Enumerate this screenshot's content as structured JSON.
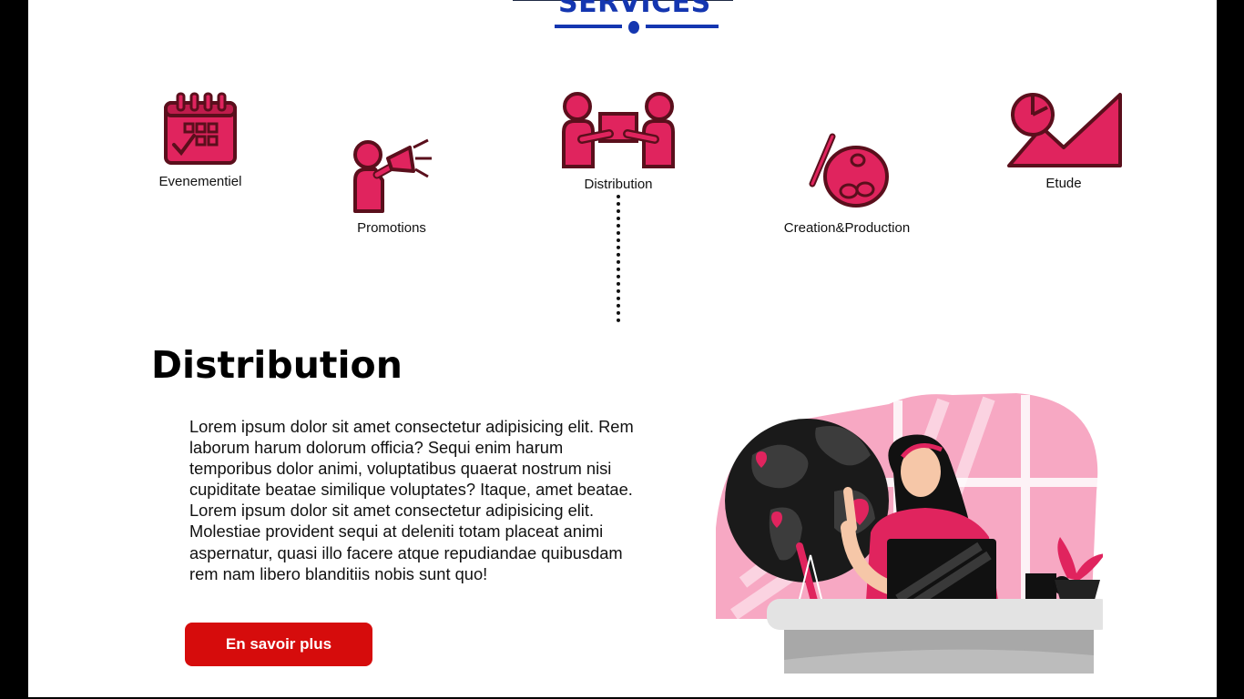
{
  "section": {
    "title": "SERVICES"
  },
  "services": [
    {
      "label": "Evenementiel",
      "icon": "calendar-icon"
    },
    {
      "label": "Promotions",
      "icon": "megaphone-icon"
    },
    {
      "label": "Distribution",
      "icon": "handover-icon"
    },
    {
      "label": "Creation&Production",
      "icon": "palette-icon"
    },
    {
      "label": "Etude",
      "icon": "chart-study-icon"
    }
  ],
  "detail": {
    "title": "Distribution",
    "body": "Lorem ipsum dolor sit amet consectetur adipisicing elit. Rem laborum harum dolorum officia? Sequi enim harum temporibus dolor animi, voluptatibus quaerat nostrum nisi cupiditate beatae similique voluptates? Itaque, amet beatae. Lorem ipsum dolor sit amet consectetur adipisicing elit. Molestiae provident sequi at deleniti totam placeat animi aspernatur, quasi illo facere atque repudiandae quibusdam rem nam libero blanditiis nobis sunt quo!",
    "button_label": "En savoir plus"
  },
  "colors": {
    "brand_blue": "#1436b0",
    "icon_red": "#e0245e",
    "icon_outline": "#5a0f1c",
    "button_red": "#d60c0c"
  }
}
